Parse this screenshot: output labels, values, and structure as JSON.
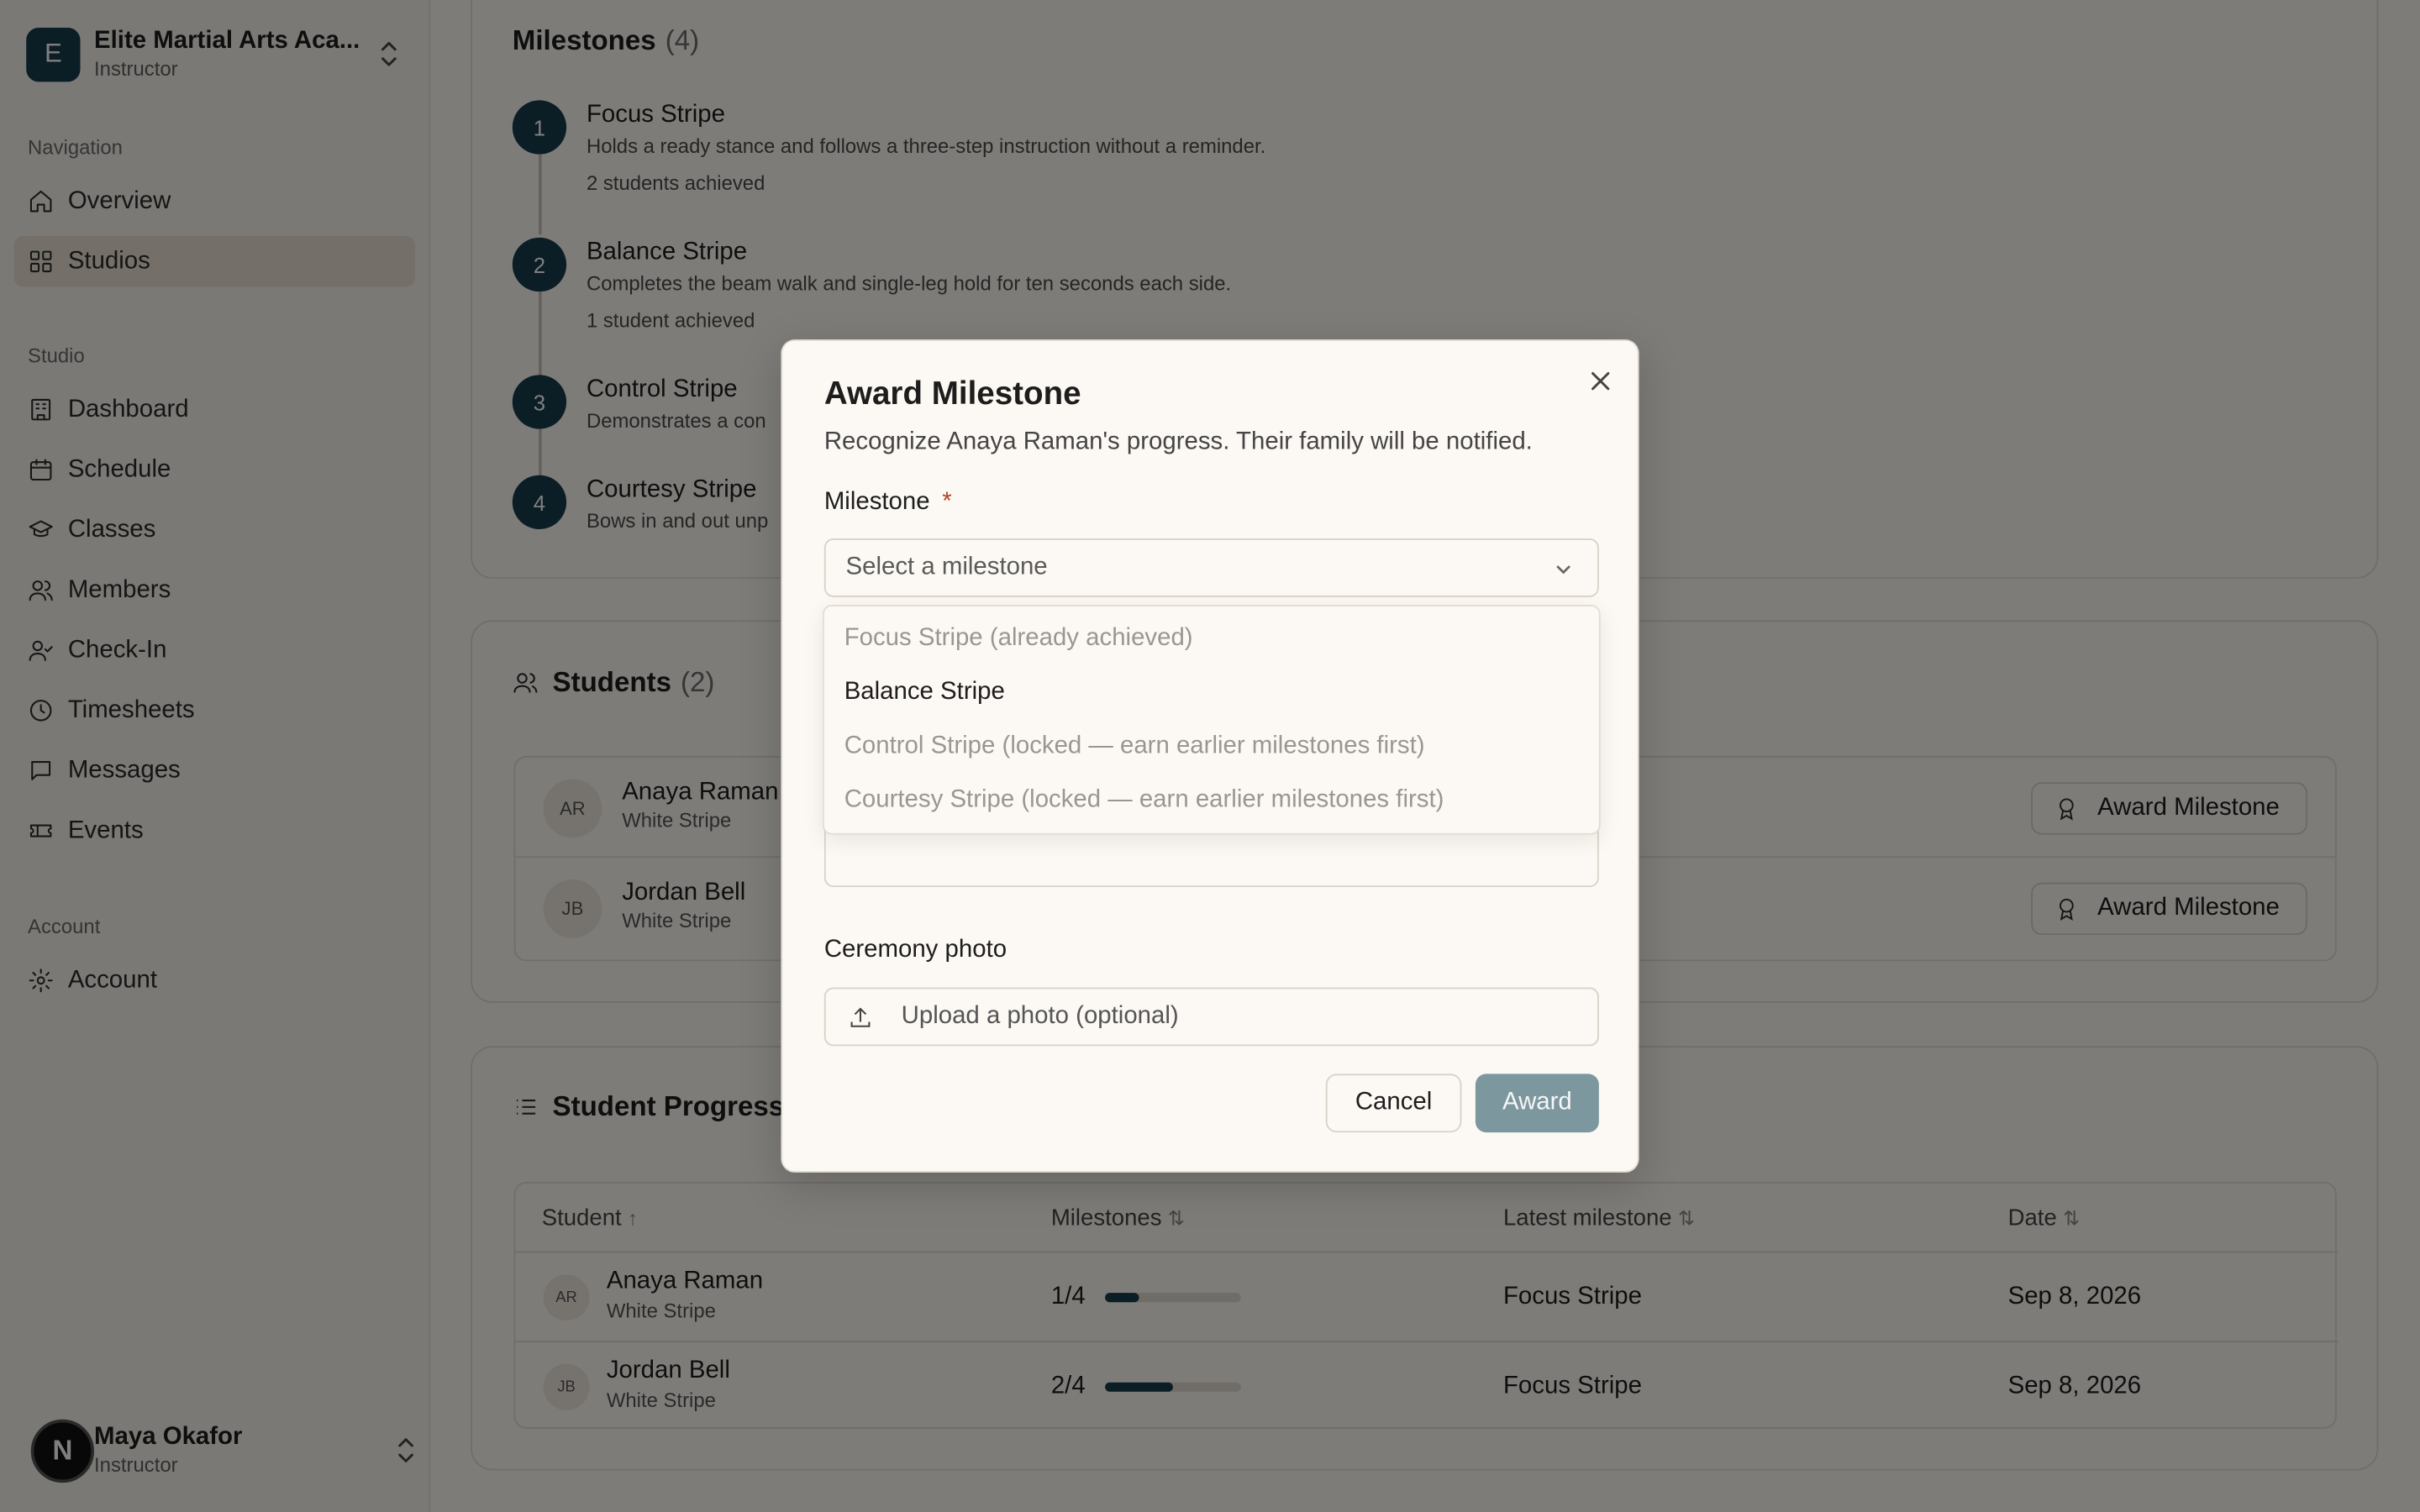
{
  "org": {
    "initial": "E",
    "name": "Elite Martial Arts Aca...",
    "role": "Instructor"
  },
  "nav": {
    "navigation_label": "Navigation",
    "navigation": [
      {
        "label": "Overview",
        "icon": "home-icon"
      },
      {
        "label": "Studios",
        "icon": "grid-icon",
        "active": true
      }
    ],
    "studio_label": "Studio",
    "studio": [
      {
        "label": "Dashboard",
        "icon": "building-icon"
      },
      {
        "label": "Schedule",
        "icon": "calendar-icon"
      },
      {
        "label": "Classes",
        "icon": "graduation-cap-icon"
      },
      {
        "label": "Members",
        "icon": "users-icon"
      },
      {
        "label": "Check-In",
        "icon": "user-check-icon"
      },
      {
        "label": "Timesheets",
        "icon": "clock-icon"
      },
      {
        "label": "Messages",
        "icon": "message-icon"
      },
      {
        "label": "Events",
        "icon": "ticket-icon"
      }
    ],
    "account_label": "Account",
    "account": [
      {
        "label": "Account",
        "icon": "gear-icon"
      }
    ]
  },
  "user": {
    "initial": "N",
    "name": "Maya Okafor",
    "role": "Instructor"
  },
  "milestones": {
    "title": "Milestones",
    "count": "(4)",
    "items": [
      {
        "num": "1",
        "name": "Focus Stripe",
        "desc": "Holds a ready stance and follows a three-step instruction without a reminder.",
        "achieved": "2 students achieved"
      },
      {
        "num": "2",
        "name": "Balance Stripe",
        "desc": "Completes the beam walk and single-leg hold for ten seconds each side.",
        "achieved": "1 student achieved"
      },
      {
        "num": "3",
        "name": "Control Stripe",
        "desc": "Demonstrates a con"
      },
      {
        "num": "4",
        "name": "Courtesy Stripe",
        "desc": "Bows in and out unp"
      }
    ]
  },
  "students": {
    "title": "Students",
    "count": "(2)",
    "rows": [
      {
        "initials": "AR",
        "name": "Anaya Raman",
        "rank": "White Stripe",
        "action": "Award Milestone"
      },
      {
        "initials": "JB",
        "name": "Jordan Bell",
        "rank": "White Stripe",
        "action": "Award Milestone"
      }
    ]
  },
  "progress": {
    "title": "Student Progress",
    "columns": {
      "student": "Student",
      "milestones": "Milestones",
      "latest": "Latest milestone",
      "date": "Date"
    },
    "sort_icons": {
      "asc": "↑",
      "both": "⇅"
    },
    "rows": [
      {
        "initials": "AR",
        "name": "Anaya Raman",
        "rank": "White Stripe",
        "count": "1/4",
        "fraction": 0.25,
        "latest": "Focus Stripe",
        "date": "Sep 8, 2026"
      },
      {
        "initials": "JB",
        "name": "Jordan Bell",
        "rank": "White Stripe",
        "count": "2/4",
        "fraction": 0.5,
        "latest": "Focus Stripe",
        "date": "Sep 8, 2026"
      }
    ]
  },
  "modal": {
    "title": "Award Milestone",
    "description": "Recognize Anaya Raman's progress. Their family will be notified.",
    "milestone_label": "Milestone",
    "required_mark": "*",
    "select_placeholder": "Select a milestone",
    "options": [
      {
        "label": "Focus Stripe (already achieved)",
        "disabled": true
      },
      {
        "label": "Balance Stripe",
        "disabled": false
      },
      {
        "label": "Control Stripe (locked — earn earlier milestones first)",
        "disabled": true
      },
      {
        "label": "Courtesy Stripe (locked — earn earlier milestones first)",
        "disabled": true
      }
    ],
    "photo_label": "Ceremony photo",
    "upload_label": "Upload a photo (optional)",
    "cancel_label": "Cancel",
    "award_label": "Award"
  },
  "colors": {
    "accent": "#163b4b",
    "award_button": "#7d979f",
    "required": "#b5421f"
  }
}
